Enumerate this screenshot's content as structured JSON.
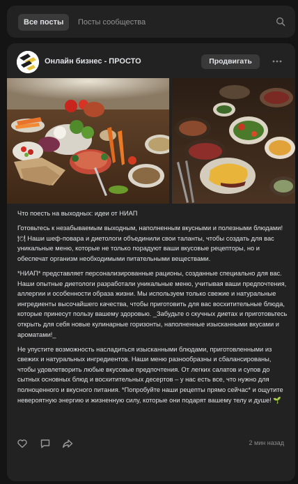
{
  "tabs": {
    "all_posts": "Все посты",
    "community_posts": "Посты сообщества"
  },
  "post": {
    "channel_name": "Онлайн бизнес - ПРОСТО",
    "promote_label": "Продвигать",
    "paragraphs": [
      "Что поесть на выходных: идеи от НИАП",
      "Готовьтесь к незабываемым выходным, наполненным вкусными и полезными блюдами! 🍽 Наши шеф-повара и диетологи объединили свои таланты, чтобы создать для вас уникальные меню, которые не только порадуют ваши вкусовые рецепторы, но и обеспечат организм необходимыми питательными веществами.",
      "*НИАП* представляет персонализированные рационы, созданные специально для вас. Наши опытные диетологи разработали уникальные меню, учитывая ваши предпочтения, аллергии и особенности образа жизни. Мы используем только свежие и натуральные ингредиенты высочайшего качества, чтобы приготовить для вас восхитительные блюда, которые принесут пользу вашему здоровью. _Забудьте о скучных диетах и приготовьтесь открыть для себя новые кулинарные горизонты, наполненные изысканными вкусами и ароматами!_",
      "Не упустите возможность насладиться изысканными блюдами, приготовленными из свежих и натуральных ингредиентов. Наши меню разнообразны и сбалансированы, чтобы удовлетворить любые вкусовые предпочтения. От легких салатов и супов до сытных основных блюд и восхитительных десертов – у нас есть все, что нужно для полноценного и вкусного питания. *Попробуйте наши рецепты прямо сейчас* и ощутите невероятную энергию и жизненную силу, которые они подарят вашему телу и душе! 🌱"
    ],
    "timestamp": "2 мин назад"
  },
  "icons": {
    "search": "search-icon",
    "more": "more-horizontal-icon",
    "like": "heart-icon",
    "comment": "comment-icon",
    "share": "share-icon"
  },
  "colors": {
    "page_bg": "#141414",
    "card_bg": "#222222",
    "active_tab_bg": "#3a3a3a",
    "button_bg": "#393939",
    "text_primary": "#e1e3e6",
    "text_secondary": "#939393"
  }
}
